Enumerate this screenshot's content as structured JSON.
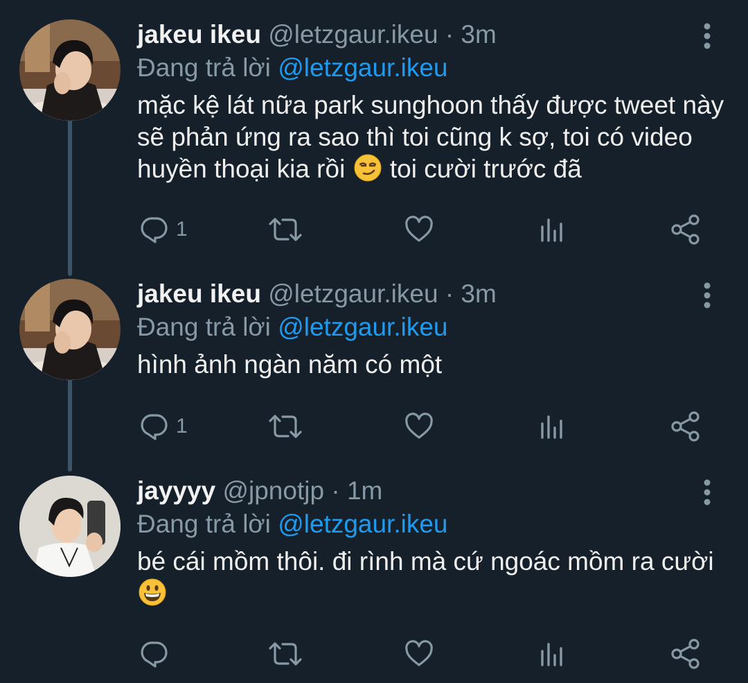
{
  "tweets": [
    {
      "display_name": "jakeu ikeu",
      "handle": "@letzgaur.ikeu",
      "separator": "·",
      "time": "3m",
      "reply_prefix": "Đang trả lời",
      "reply_to": "@letzgaur.ikeu",
      "text_before_emoji": "mặc kệ lát nữa park sunghoon thấy được tweet này sẽ phản ứng ra sao thì toi cũng k sợ, toi có video huyền thoại kia rồi",
      "emoji": "smirking-face",
      "text_after_emoji": "toi cười trước đã",
      "reply_count": "1"
    },
    {
      "display_name": "jakeu ikeu",
      "handle": "@letzgaur.ikeu",
      "separator": "·",
      "time": "3m",
      "reply_prefix": "Đang trả lời",
      "reply_to": "@letzgaur.ikeu",
      "text": "hình ảnh ngàn năm có một",
      "reply_count": "1"
    },
    {
      "display_name": "jayyyy",
      "handle": "@jpnotjp",
      "separator": "·",
      "time": "1m",
      "reply_prefix": "Đang trả lời",
      "reply_to": "@letzgaur.ikeu",
      "text_before_emoji": "bé cái mồm thôi. đi rình mà cứ ngoác mồm ra cười",
      "emoji": "grinning-face",
      "reply_count": ""
    }
  ],
  "icons": {
    "reply": "reply-icon",
    "retweet": "retweet-icon",
    "like": "heart-icon",
    "views": "views-icon",
    "share": "share-icon",
    "more": "more-vertical-icon"
  },
  "colors": {
    "background": "#15202b",
    "muted": "#8899a6",
    "mention": "#1d9bf0",
    "thread_line": "#3d5466"
  }
}
